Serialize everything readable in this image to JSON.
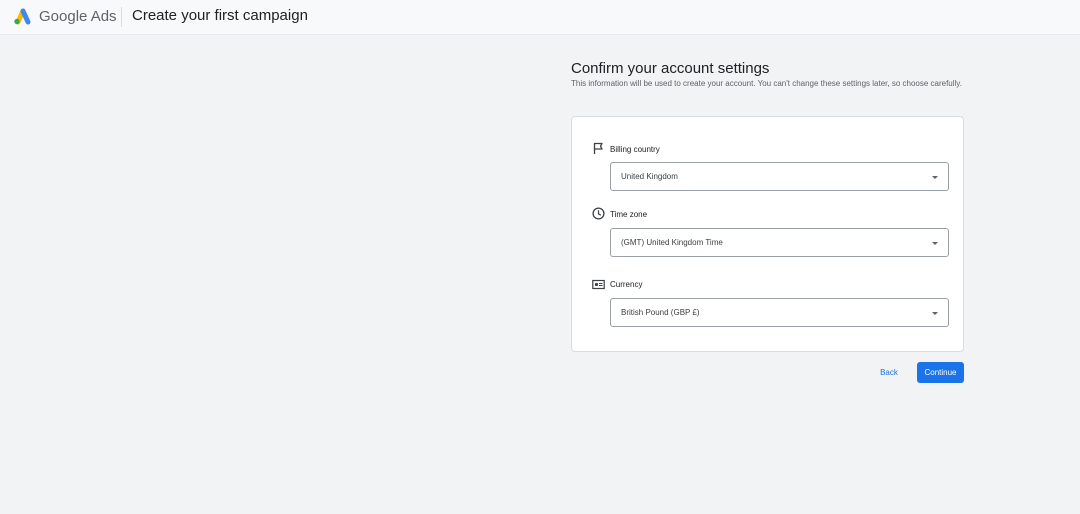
{
  "header": {
    "brand": "Google Ads",
    "title": "Create your first campaign"
  },
  "main": {
    "heading": "Confirm your account settings",
    "description": "This information will be used to create your account. You can't change these settings later, so choose carefully.",
    "fields": [
      {
        "icon": "flag-icon",
        "label": "Billing country",
        "value": "United Kingdom"
      },
      {
        "icon": "clock-icon",
        "label": "Time zone",
        "value": "(GMT) United Kingdom Time"
      },
      {
        "icon": "currency-icon",
        "label": "Currency",
        "value": "British Pound (GBP £)"
      }
    ],
    "back_label": "Back",
    "continue_label": "Continue"
  },
  "colors": {
    "accent": "#1a73e8",
    "background": "#f1f3f4",
    "card": "#ffffff"
  }
}
